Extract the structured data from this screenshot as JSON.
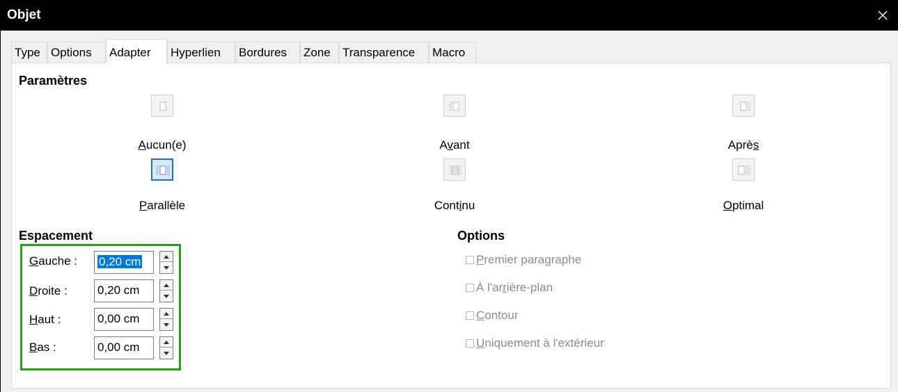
{
  "window": {
    "title": "Objet"
  },
  "tabs": [
    {
      "label": "Type"
    },
    {
      "label": "Options"
    },
    {
      "label": "Adapter",
      "active": true
    },
    {
      "label": "Hyperlien"
    },
    {
      "label": "Bordures"
    },
    {
      "label": "Zone"
    },
    {
      "label": "Transparence"
    },
    {
      "label": "Macro"
    }
  ],
  "parametres": {
    "title": "Paramètres",
    "items": [
      {
        "pre": "",
        "key": "A",
        "post": "ucun(e)",
        "icon": "wrap-none-icon"
      },
      {
        "pre": "A",
        "key": "v",
        "post": "ant",
        "icon": "wrap-before-icon"
      },
      {
        "pre": "Aprè",
        "key": "s",
        "post": "",
        "icon": "wrap-after-icon"
      },
      {
        "pre": "",
        "key": "P",
        "post": "arallèle",
        "icon": "wrap-parallel-icon",
        "selected": true
      },
      {
        "pre": "Cont",
        "key": "i",
        "post": "nu",
        "icon": "wrap-through-icon"
      },
      {
        "pre": "",
        "key": "O",
        "post": "ptimal",
        "icon": "wrap-optimal-icon"
      }
    ]
  },
  "espacement": {
    "title": "Espacement",
    "fields": [
      {
        "key": "G",
        "post": "auche :",
        "value": "0,20 cm",
        "selected": true
      },
      {
        "key": "D",
        "post": "roite :",
        "value": "0,20 cm"
      },
      {
        "key": "H",
        "post": "aut :",
        "value": "0,00 cm"
      },
      {
        "key": "B",
        "post": "as :",
        "value": "0,00 cm"
      }
    ]
  },
  "options": {
    "title": "Options",
    "items": [
      {
        "pre": "",
        "key": "P",
        "post": "remier paragraphe",
        "checked": false
      },
      {
        "pre": "À l'ar",
        "key": "r",
        "post": "ière-plan",
        "checked": false
      },
      {
        "pre": "",
        "key": "C",
        "post": "ontour",
        "checked": false
      },
      {
        "pre": "",
        "key": "U",
        "post": "niquement à l'extérieur",
        "checked": false
      }
    ]
  },
  "colors": {
    "highlight": "#1fa317",
    "selection": "#0078d7",
    "title_bar": "#000000"
  }
}
